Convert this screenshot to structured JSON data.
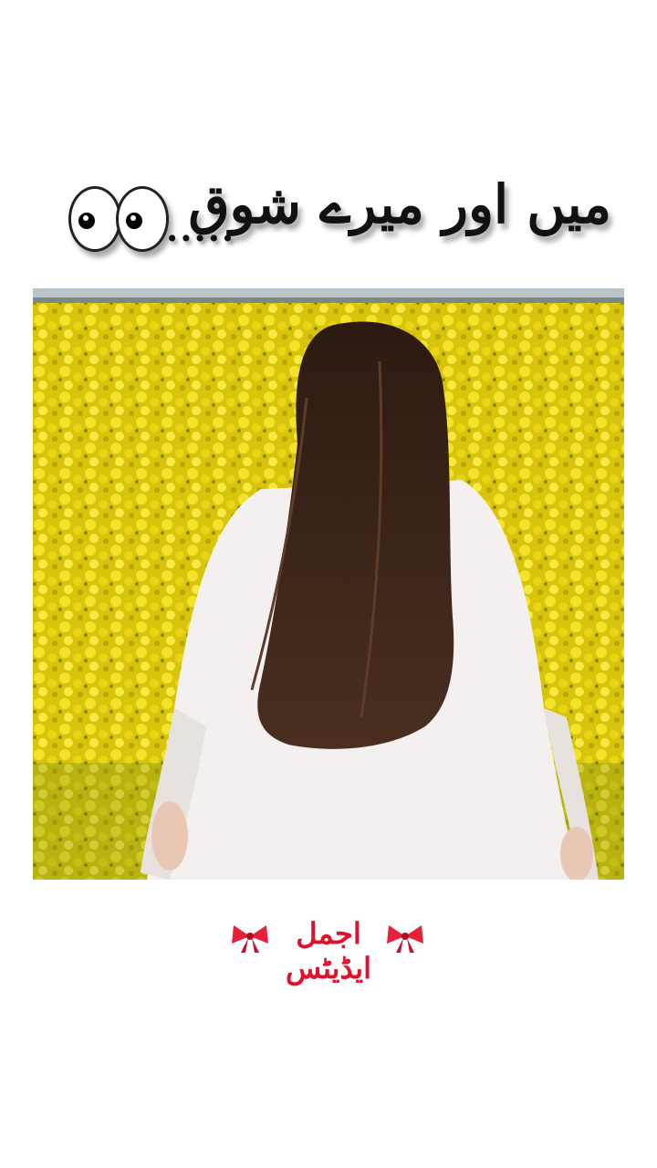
{
  "header": {
    "title": "میں اور میرے شوق",
    "dots": ".....",
    "icon": "eyes-emoji"
  },
  "photo": {
    "subject": "woman-in-white-dress-in-mustard-field",
    "colors": {
      "flowers": "#e6d40f",
      "dress": "#f4f0ef",
      "hair": "#3a2417",
      "sky": "#b9c3c8"
    }
  },
  "signature": {
    "text": "اجمل ایڈیٹس",
    "color": "#e0112b",
    "icon": "ribbon-bow"
  }
}
